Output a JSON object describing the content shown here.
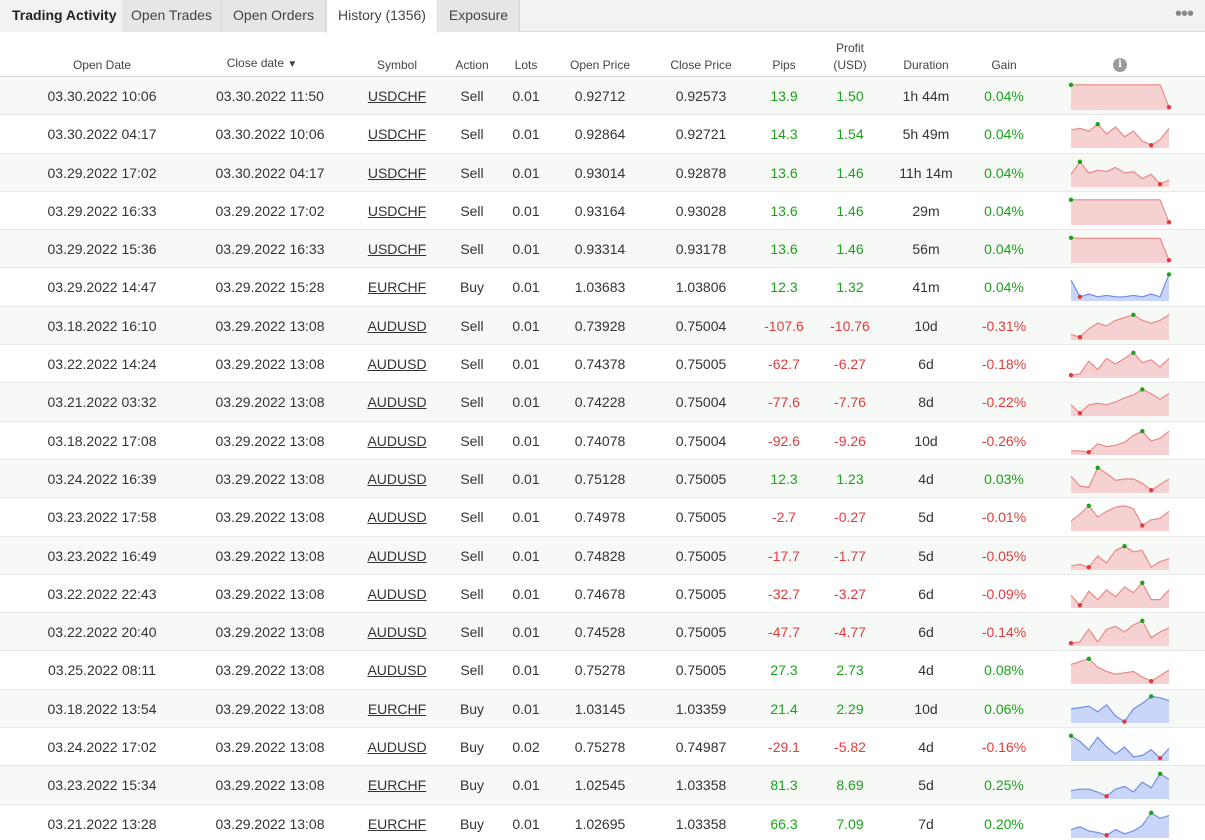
{
  "tabs": [
    {
      "label": "Trading Activity"
    },
    {
      "label": "Open Trades"
    },
    {
      "label": "Open Orders"
    },
    {
      "label": "History (1356)"
    },
    {
      "label": "Exposure"
    }
  ],
  "menu_icon": "more-dots-icon",
  "columns": {
    "open_date": "Open Date",
    "close_date": "Close date",
    "sort_indicator": "▼",
    "symbol": "Symbol",
    "action": "Action",
    "lots": "Lots",
    "open_price": "Open Price",
    "close_price": "Close Price",
    "pips": "Pips",
    "profit_line1": "Profit",
    "profit_line2": "(USD)",
    "duration": "Duration",
    "gain": "Gain",
    "info_icon": "i"
  },
  "colors": {
    "positive": "#1aa31a",
    "negative": "#e03c3c",
    "sell_fill": "#f5d1d1",
    "sell_line": "#e88a8a",
    "buy_fill": "#c9d6fa",
    "buy_line": "#6f8fe6"
  },
  "rows": [
    {
      "open": "03.30.2022 10:06",
      "close": "03.30.2022 11:50",
      "symbol": "USDCHF",
      "action": "Sell",
      "lots": "0.01",
      "open_price": "0.92712",
      "close_price": "0.92573",
      "pips": "13.9",
      "profit": "1.50",
      "duration": "1h 44m",
      "gain": "0.04%",
      "spark": [
        0.1,
        0.1,
        0.1,
        0.1,
        0.1,
        0.1,
        0.1,
        0.1,
        0.1,
        0.1,
        0.1,
        0.9
      ]
    },
    {
      "open": "03.30.2022 04:17",
      "close": "03.30.2022 10:06",
      "symbol": "USDCHF",
      "action": "Sell",
      "lots": "0.01",
      "open_price": "0.92864",
      "close_price": "0.92721",
      "pips": "14.3",
      "profit": "1.54",
      "duration": "5h 49m",
      "gain": "0.04%",
      "spark": [
        0.35,
        0.3,
        0.4,
        0.15,
        0.5,
        0.25,
        0.6,
        0.4,
        0.75,
        0.9,
        0.7,
        0.3
      ]
    },
    {
      "open": "03.29.2022 17:02",
      "close": "03.30.2022 04:17",
      "symbol": "USDCHF",
      "action": "Sell",
      "lots": "0.01",
      "open_price": "0.93014",
      "close_price": "0.92878",
      "pips": "13.6",
      "profit": "1.46",
      "duration": "11h 14m",
      "gain": "0.04%",
      "spark": [
        0.55,
        0.1,
        0.5,
        0.4,
        0.45,
        0.3,
        0.5,
        0.45,
        0.7,
        0.55,
        0.9,
        0.75
      ]
    },
    {
      "open": "03.29.2022 16:33",
      "close": "03.29.2022 17:02",
      "symbol": "USDCHF",
      "action": "Sell",
      "lots": "0.01",
      "open_price": "0.93164",
      "close_price": "0.93028",
      "pips": "13.6",
      "profit": "1.46",
      "duration": "29m",
      "gain": "0.04%",
      "spark": [
        0.1,
        0.1,
        0.1,
        0.1,
        0.1,
        0.1,
        0.1,
        0.1,
        0.1,
        0.1,
        0.1,
        0.9
      ]
    },
    {
      "open": "03.29.2022 15:36",
      "close": "03.29.2022 16:33",
      "symbol": "USDCHF",
      "action": "Sell",
      "lots": "0.01",
      "open_price": "0.93314",
      "close_price": "0.93178",
      "pips": "13.6",
      "profit": "1.46",
      "duration": "56m",
      "gain": "0.04%",
      "spark": [
        0.1,
        0.12,
        0.12,
        0.12,
        0.12,
        0.12,
        0.12,
        0.12,
        0.12,
        0.12,
        0.12,
        0.9
      ]
    },
    {
      "open": "03.29.2022 14:47",
      "close": "03.29.2022 15:28",
      "symbol": "EURCHF",
      "action": "Buy",
      "lots": "0.01",
      "open_price": "1.03683",
      "close_price": "1.03806",
      "pips": "12.3",
      "profit": "1.32",
      "duration": "41m",
      "gain": "0.04%",
      "spark": [
        0.25,
        0.85,
        0.75,
        0.85,
        0.8,
        0.85,
        0.85,
        0.8,
        0.85,
        0.75,
        0.85,
        0.05
      ]
    },
    {
      "open": "03.18.2022 16:10",
      "close": "03.29.2022 13:08",
      "symbol": "AUDUSD",
      "action": "Sell",
      "lots": "0.01",
      "open_price": "0.73928",
      "close_price": "0.75004",
      "pips": "-107.6",
      "profit": "-10.76",
      "duration": "10d",
      "gain": "-0.31%",
      "spark": [
        0.8,
        0.9,
        0.6,
        0.4,
        0.5,
        0.3,
        0.2,
        0.1,
        0.3,
        0.4,
        0.3,
        0.1
      ]
    },
    {
      "open": "03.22.2022 14:24",
      "close": "03.29.2022 13:08",
      "symbol": "AUDUSD",
      "action": "Sell",
      "lots": "0.01",
      "open_price": "0.74378",
      "close_price": "0.75005",
      "pips": "-62.7",
      "profit": "-6.27",
      "duration": "6d",
      "gain": "-0.18%",
      "spark": [
        0.9,
        0.85,
        0.4,
        0.7,
        0.3,
        0.5,
        0.3,
        0.1,
        0.45,
        0.35,
        0.6,
        0.3
      ]
    },
    {
      "open": "03.21.2022 03:32",
      "close": "03.29.2022 13:08",
      "symbol": "AUDUSD",
      "action": "Sell",
      "lots": "0.01",
      "open_price": "0.74228",
      "close_price": "0.75004",
      "pips": "-77.6",
      "profit": "-7.76",
      "duration": "8d",
      "gain": "-0.22%",
      "spark": [
        0.6,
        0.9,
        0.6,
        0.55,
        0.6,
        0.5,
        0.35,
        0.25,
        0.05,
        0.2,
        0.4,
        0.2
      ]
    },
    {
      "open": "03.18.2022 17:08",
      "close": "03.29.2022 13:08",
      "symbol": "AUDUSD",
      "action": "Sell",
      "lots": "0.01",
      "open_price": "0.74078",
      "close_price": "0.75004",
      "pips": "-92.6",
      "profit": "-9.26",
      "duration": "10d",
      "gain": "-0.26%",
      "spark": [
        0.85,
        0.85,
        0.9,
        0.6,
        0.7,
        0.65,
        0.55,
        0.3,
        0.15,
        0.5,
        0.4,
        0.15
      ]
    },
    {
      "open": "03.24.2022 16:39",
      "close": "03.29.2022 13:08",
      "symbol": "AUDUSD",
      "action": "Sell",
      "lots": "0.01",
      "open_price": "0.75128",
      "close_price": "0.75005",
      "pips": "12.3",
      "profit": "1.23",
      "duration": "4d",
      "gain": "0.03%",
      "spark": [
        0.4,
        0.75,
        0.8,
        0.1,
        0.3,
        0.55,
        0.5,
        0.5,
        0.65,
        0.9,
        0.7,
        0.5
      ]
    },
    {
      "open": "03.23.2022 17:58",
      "close": "03.29.2022 13:08",
      "symbol": "AUDUSD",
      "action": "Sell",
      "lots": "0.01",
      "open_price": "0.74978",
      "close_price": "0.75005",
      "pips": "-2.7",
      "profit": "-0.27",
      "duration": "5d",
      "gain": "-0.01%",
      "spark": [
        0.65,
        0.4,
        0.1,
        0.5,
        0.3,
        0.15,
        0.1,
        0.2,
        0.8,
        0.6,
        0.55,
        0.3
      ]
    },
    {
      "open": "03.23.2022 16:49",
      "close": "03.29.2022 13:08",
      "symbol": "AUDUSD",
      "action": "Sell",
      "lots": "0.01",
      "open_price": "0.74828",
      "close_price": "0.75005",
      "pips": "-17.7",
      "profit": "-1.77",
      "duration": "5d",
      "gain": "-0.05%",
      "spark": [
        0.85,
        0.8,
        0.9,
        0.5,
        0.75,
        0.3,
        0.15,
        0.35,
        0.3,
        0.9,
        0.7,
        0.6
      ]
    },
    {
      "open": "03.22.2022 22:43",
      "close": "03.29.2022 13:08",
      "symbol": "AUDUSD",
      "action": "Sell",
      "lots": "0.01",
      "open_price": "0.74678",
      "close_price": "0.75005",
      "pips": "-32.7",
      "profit": "-3.27",
      "duration": "6d",
      "gain": "-0.09%",
      "spark": [
        0.55,
        0.9,
        0.4,
        0.7,
        0.35,
        0.6,
        0.25,
        0.45,
        0.1,
        0.7,
        0.7,
        0.35
      ]
    },
    {
      "open": "03.22.2022 20:40",
      "close": "03.29.2022 13:08",
      "symbol": "AUDUSD",
      "action": "Sell",
      "lots": "0.01",
      "open_price": "0.74528",
      "close_price": "0.75005",
      "pips": "-47.7",
      "profit": "-4.77",
      "duration": "6d",
      "gain": "-0.14%",
      "spark": [
        0.9,
        0.85,
        0.4,
        0.85,
        0.4,
        0.3,
        0.5,
        0.25,
        0.1,
        0.7,
        0.5,
        0.35
      ]
    },
    {
      "open": "03.25.2022 08:11",
      "close": "03.29.2022 13:08",
      "symbol": "AUDUSD",
      "action": "Sell",
      "lots": "0.01",
      "open_price": "0.75278",
      "close_price": "0.75005",
      "pips": "27.3",
      "profit": "2.73",
      "duration": "4d",
      "gain": "0.08%",
      "spark": [
        0.3,
        0.2,
        0.1,
        0.4,
        0.55,
        0.65,
        0.6,
        0.55,
        0.75,
        0.9,
        0.7,
        0.5
      ]
    },
    {
      "open": "03.18.2022 13:54",
      "close": "03.29.2022 13:08",
      "symbol": "EURCHF",
      "action": "Buy",
      "lots": "0.01",
      "open_price": "1.03145",
      "close_price": "1.03359",
      "pips": "21.4",
      "profit": "2.29",
      "duration": "10d",
      "gain": "0.06%",
      "spark": [
        0.5,
        0.45,
        0.4,
        0.6,
        0.35,
        0.75,
        0.95,
        0.5,
        0.3,
        0.05,
        0.1,
        0.2
      ]
    },
    {
      "open": "03.24.2022 17:02",
      "close": "03.29.2022 13:08",
      "symbol": "AUDUSD",
      "action": "Buy",
      "lots": "0.02",
      "open_price": "0.75278",
      "close_price": "0.74987",
      "pips": "-29.1",
      "profit": "-5.82",
      "duration": "4d",
      "gain": "-0.16%",
      "spark": [
        0.1,
        0.3,
        0.6,
        0.15,
        0.5,
        0.75,
        0.5,
        0.85,
        0.8,
        0.6,
        0.9,
        0.55
      ]
    },
    {
      "open": "03.23.2022 15:34",
      "close": "03.29.2022 13:08",
      "symbol": "EURCHF",
      "action": "Buy",
      "lots": "0.01",
      "open_price": "1.02545",
      "close_price": "1.03358",
      "pips": "81.3",
      "profit": "8.69",
      "duration": "5d",
      "gain": "0.25%",
      "spark": [
        0.7,
        0.65,
        0.65,
        0.75,
        0.9,
        0.65,
        0.55,
        0.75,
        0.4,
        0.6,
        0.1,
        0.3
      ]
    },
    {
      "open": "03.21.2022 13:28",
      "close": "03.29.2022 13:08",
      "symbol": "EURCHF",
      "action": "Buy",
      "lots": "0.01",
      "open_price": "1.02695",
      "close_price": "1.03358",
      "pips": "66.3",
      "profit": "7.09",
      "duration": "7d",
      "gain": "0.20%",
      "spark": [
        0.7,
        0.6,
        0.75,
        0.8,
        0.9,
        0.7,
        0.85,
        0.75,
        0.55,
        0.1,
        0.3,
        0.2
      ]
    }
  ]
}
